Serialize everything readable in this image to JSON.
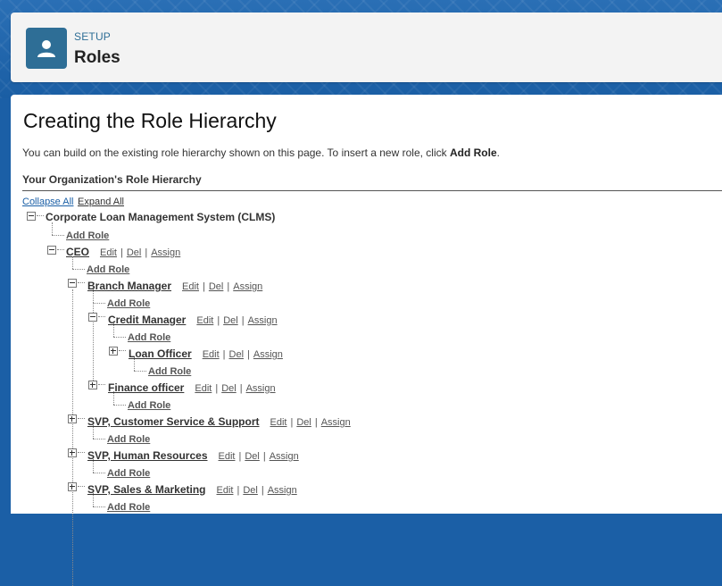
{
  "header": {
    "setup_label": "SETUP",
    "title": "Roles",
    "icon": "user-icon",
    "accent": "#2e6e96"
  },
  "main": {
    "title": "Creating the Role Hierarchy",
    "intro_text": "You can build on the existing role hierarchy shown on this page. To insert a new role, click ",
    "intro_bold": "Add Role",
    "intro_end": ".",
    "section_title": "Your Organization's Role Hierarchy",
    "collapse_all": "Collapse All",
    "expand_all": "Expand All"
  },
  "tree": {
    "root": "Corporate Loan Management System (CLMS)",
    "add_role": "Add Role",
    "actions": {
      "edit": "Edit",
      "del": "Del",
      "assign": "Assign",
      "sep": "|"
    },
    "roles": [
      {
        "name": "CEO",
        "expanded": true
      },
      {
        "name": "Branch Manager",
        "expanded": true
      },
      {
        "name": "Credit Manager",
        "expanded": true
      },
      {
        "name": "Loan Officer",
        "expanded": false
      },
      {
        "name": "Finance officer",
        "expanded": false
      },
      {
        "name": "SVP, Customer Service & Support",
        "expanded": false
      },
      {
        "name": "SVP, Human Resources",
        "expanded": false
      },
      {
        "name": "SVP, Sales & Marketing",
        "expanded": false
      }
    ]
  }
}
